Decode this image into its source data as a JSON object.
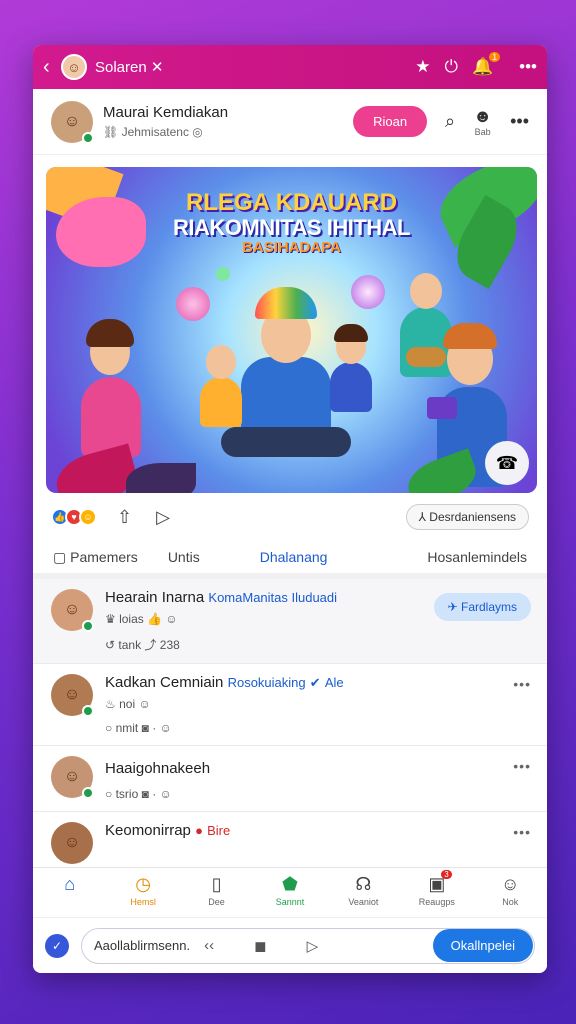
{
  "topbar": {
    "back_icon": "back-chevron-icon",
    "title": "Solaren ✕",
    "icons": [
      "star-icon",
      "power-icon",
      "bell-icon",
      "more-icon"
    ],
    "badge": "1"
  },
  "post": {
    "author": "Maurai Kemdiakan",
    "subtitle": "Jehmisatenc",
    "follow_label": "Rioan",
    "side_label": "Bab"
  },
  "banner": {
    "line1": "RLEGA KDAUARD",
    "line2": "RIAKOMNITAS IHITHAL",
    "line3": "BASIHADAPA"
  },
  "actions": {
    "pill_label": "Desrdaniensens"
  },
  "tabs": [
    "Pamemers",
    "Untis",
    "Dhalanang",
    "Hosanlemindels"
  ],
  "feed": [
    {
      "name": "Hearain Inarna",
      "highlight": "KomaManitas Iluduadi",
      "meta1": "loias",
      "meta2": "tank",
      "count": "238",
      "button": "Fardlayms"
    },
    {
      "name": "Kadkan Cemniain",
      "highlight": "Rosokuiaking",
      "tag": "Ale",
      "meta1": "noi",
      "meta2": "nmit"
    },
    {
      "name": "Haaigohnakeeh",
      "meta2": "tsrio"
    },
    {
      "name": "Keomonirrap",
      "tag": "Bire"
    }
  ],
  "nav": [
    {
      "label": "",
      "icon": "home-icon"
    },
    {
      "label": "Hemsl",
      "icon": "clock-icon"
    },
    {
      "label": "Dee",
      "icon": "bookmark-icon"
    },
    {
      "label": "Sannnt",
      "icon": "map-pin-icon"
    },
    {
      "label": "Veaniot",
      "icon": "headset-icon"
    },
    {
      "label": "Reaugps",
      "icon": "photo-icon",
      "badge": "3"
    },
    {
      "label": "Nok",
      "icon": "person-icon"
    }
  ],
  "compose": {
    "placeholder": "Aaollablirmsenn.",
    "send_label": "Okallnpelei"
  },
  "colors": {
    "accent_pink": "#d21a8e",
    "blue": "#1a5bd0",
    "send_blue": "#1d78e6"
  }
}
